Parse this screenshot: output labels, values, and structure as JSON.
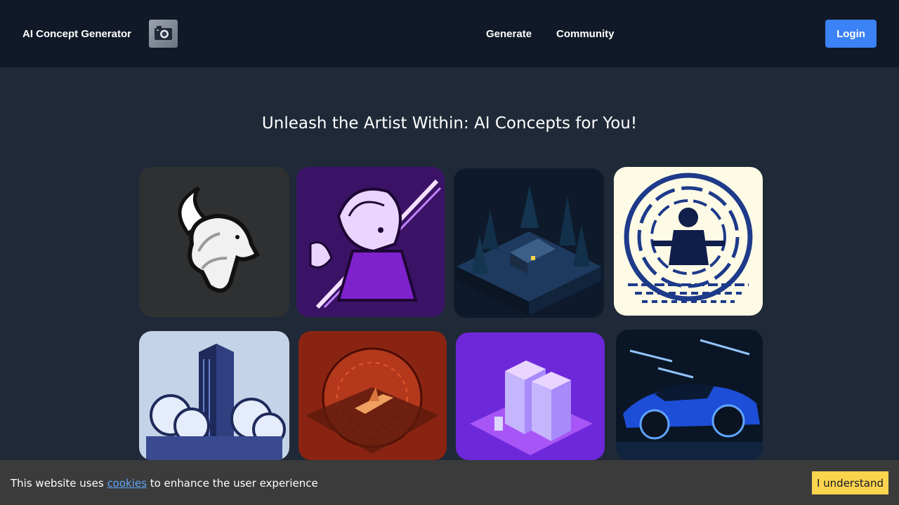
{
  "header": {
    "brand": "AI Concept Generator",
    "logo_icon": "camera-icon",
    "nav": [
      {
        "label": "Generate"
      },
      {
        "label": "Community"
      }
    ],
    "login_label": "Login"
  },
  "hero": {
    "title": "Unleash the Artist Within: AI Concepts for You!"
  },
  "gallery": [
    {
      "subject": "white goat head logo",
      "bg": "#2f3031"
    },
    {
      "subject": "anime swordsman with katana",
      "bg": "#3b1366"
    },
    {
      "subject": "isometric cabin in dark forest",
      "bg": "#0e1a2b"
    },
    {
      "subject": "figure seated on bench in circular maze",
      "bg": "#fdfbe6"
    },
    {
      "subject": "isometric skyscraper in clouds",
      "bg": "#c5d3e8"
    },
    {
      "subject": "spaceship over red planet",
      "bg": "#8a2412"
    },
    {
      "subject": "purple isometric server racks",
      "bg": "#6d28d9"
    },
    {
      "subject": "blue sports car in garage",
      "bg": "#0a1626"
    }
  ],
  "cookie": {
    "text_before": "This website uses ",
    "link": "cookies",
    "text_after": " to enhance the user experience",
    "accept_label": "I understand"
  },
  "colors": {
    "navbar_bg": "#111827",
    "page_bg": "#1f2937",
    "primary_button": "#3b82f6",
    "cookie_bar_bg": "#3b3b3b",
    "accept_button": "#fcd34d",
    "link": "#60a5fa"
  }
}
